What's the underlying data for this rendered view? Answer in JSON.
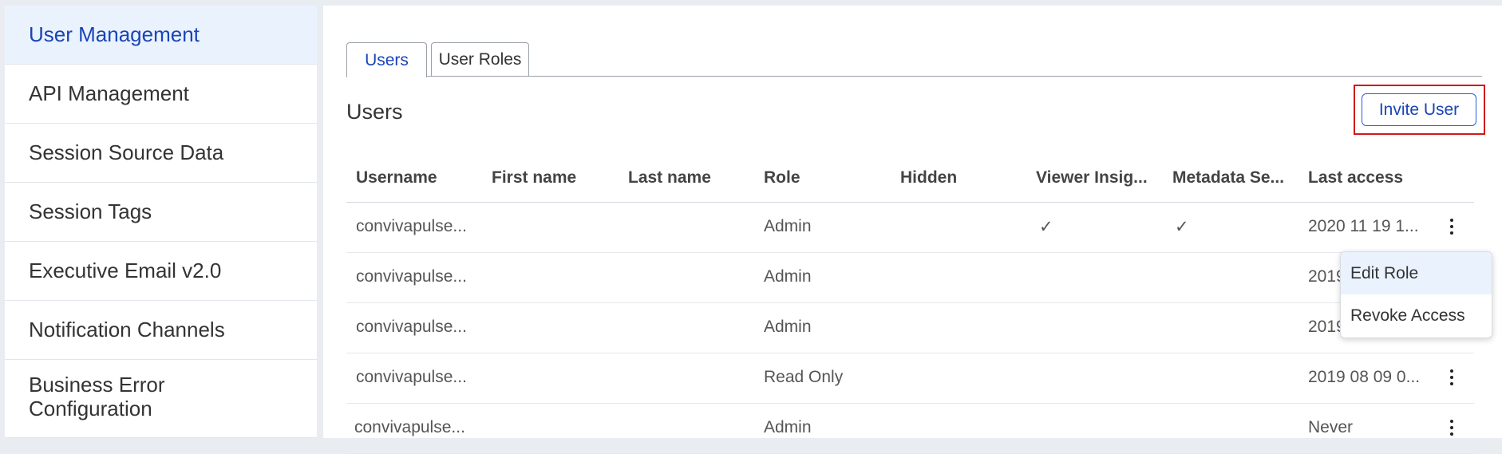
{
  "sidebar": {
    "items": [
      {
        "label": "User Management",
        "active": true
      },
      {
        "label": "API Management"
      },
      {
        "label": "Session Source Data"
      },
      {
        "label": "Session Tags"
      },
      {
        "label": "Executive Email v2.0"
      },
      {
        "label": "Notification Channels"
      },
      {
        "label": "Business Error Configuration"
      }
    ]
  },
  "tabs": [
    {
      "label": "Users",
      "active": true
    },
    {
      "label": "User Roles"
    }
  ],
  "section": {
    "title": "Users"
  },
  "toolbar": {
    "invite_label": "Invite User"
  },
  "table": {
    "headers": [
      "Username",
      "First name",
      "Last name",
      "Role",
      "Hidden",
      "Viewer Insig...",
      "Metadata Se...",
      "Last access"
    ],
    "rows": [
      {
        "username": "convivapulse...",
        "first": "",
        "last": "",
        "role": "Admin",
        "hidden": "",
        "viewer": "✓",
        "metadata": "✓",
        "last_access": "2020 11 19 1..."
      },
      {
        "username": "convivapulse...",
        "first": "",
        "last": "",
        "role": "Admin",
        "hidden": "",
        "viewer": "",
        "metadata": "",
        "last_access": "2019"
      },
      {
        "username": "convivapulse...",
        "first": "",
        "last": "",
        "role": "Admin",
        "hidden": "",
        "viewer": "",
        "metadata": "",
        "last_access": "2019"
      },
      {
        "username": "convivapulse...",
        "first": "",
        "last": "",
        "role": "Read Only",
        "hidden": "",
        "viewer": "",
        "metadata": "",
        "last_access": "2019 08 09 0..."
      },
      {
        "username": "convivapulse...",
        "first": "",
        "last": "",
        "role": "Admin",
        "hidden": "",
        "viewer": "",
        "metadata": "",
        "last_access": "Never"
      }
    ]
  },
  "menu": {
    "items": [
      "Edit Role",
      "Revoke Access"
    ]
  },
  "colors": {
    "accent": "#1a44b8",
    "highlight_border": "#d01818",
    "active_bg": "#eaf3fd"
  }
}
